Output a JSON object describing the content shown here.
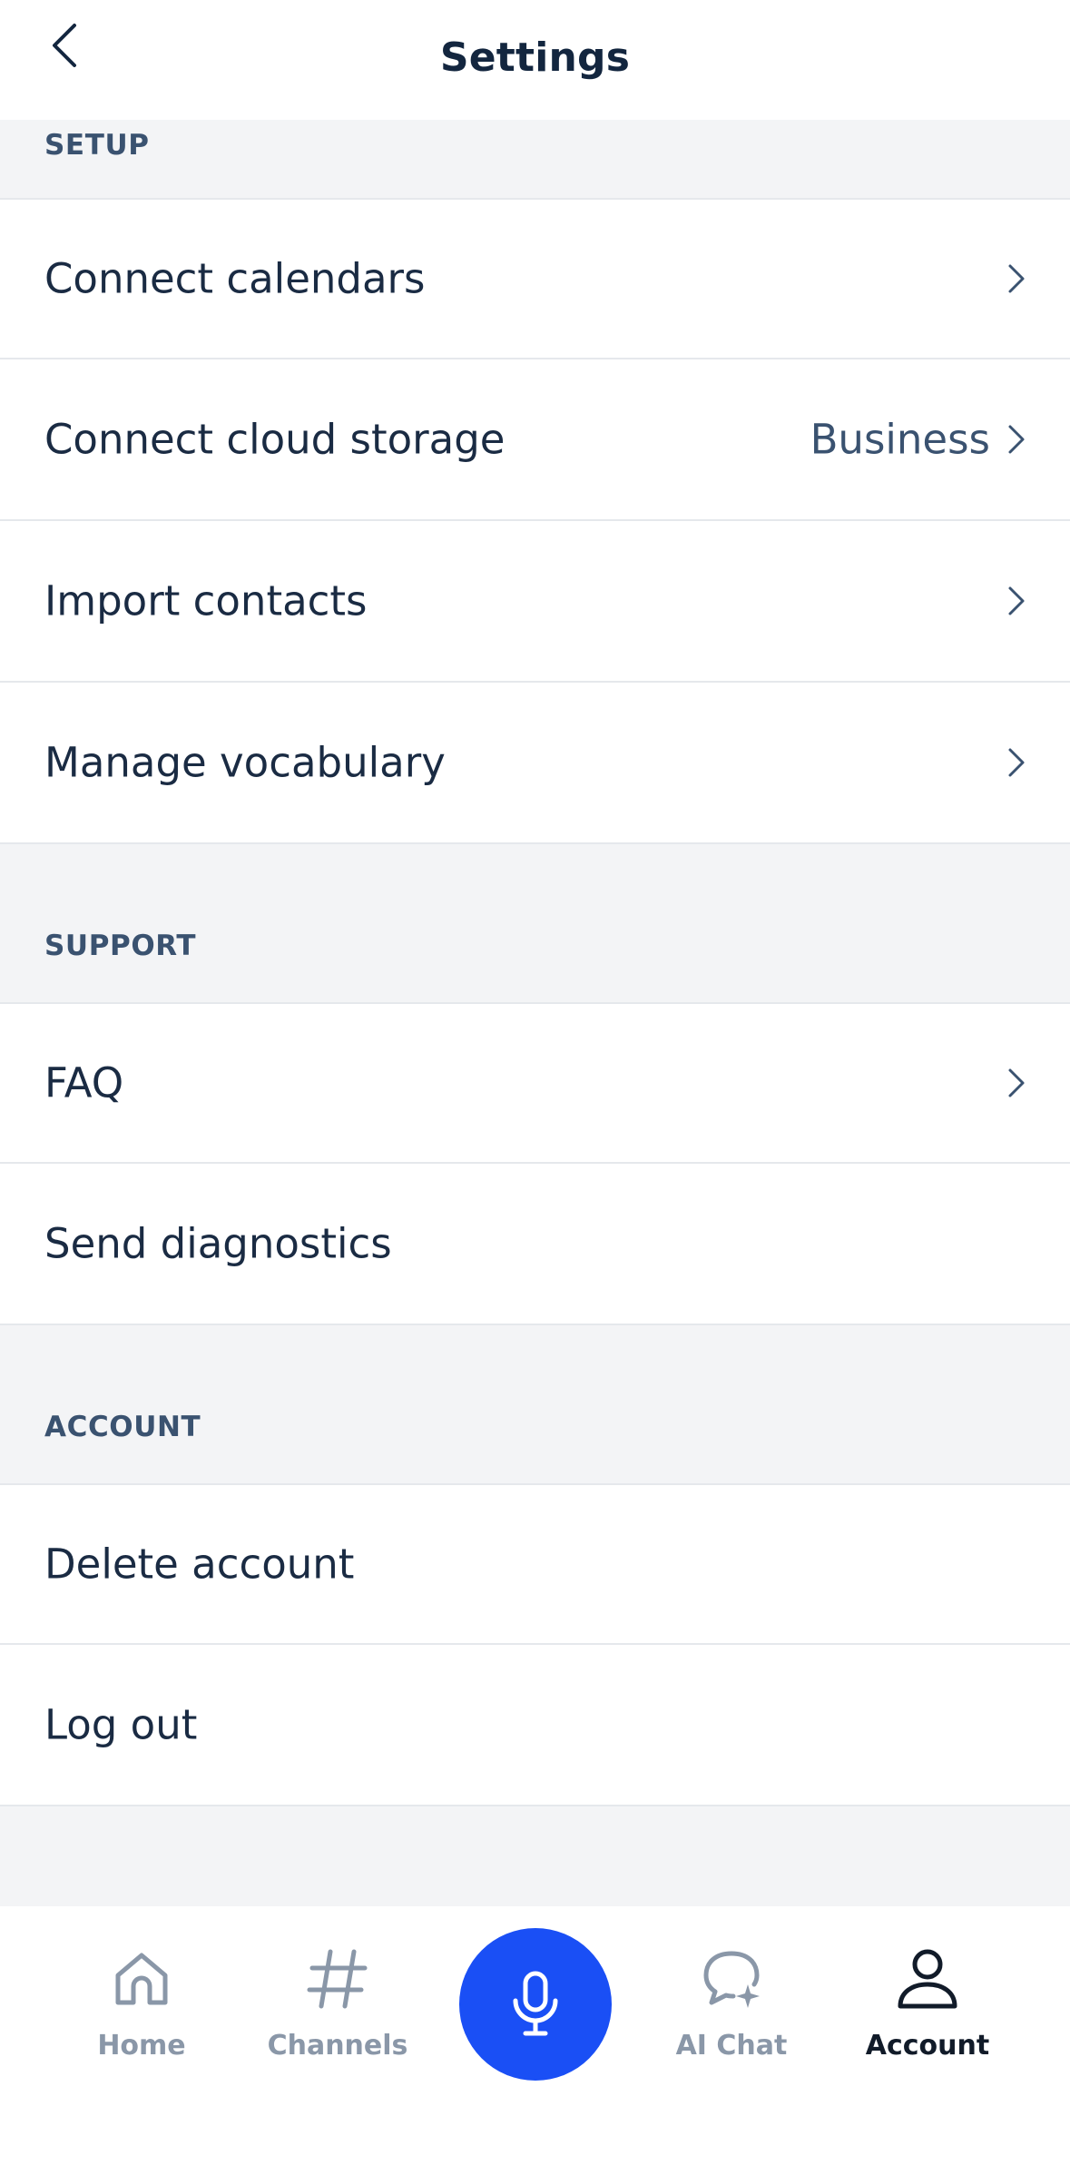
{
  "header": {
    "title": "Settings"
  },
  "sections": {
    "setup": {
      "label": "SETUP",
      "items": [
        {
          "label": "Connect calendars",
          "value": ""
        },
        {
          "label": "Connect cloud storage",
          "value": "Business"
        },
        {
          "label": "Import contacts",
          "value": ""
        },
        {
          "label": "Manage vocabulary",
          "value": ""
        }
      ]
    },
    "support": {
      "label": "SUPPORT",
      "items": [
        {
          "label": "FAQ"
        },
        {
          "label": "Send diagnostics"
        }
      ]
    },
    "account": {
      "label": "ACCOUNT",
      "items": [
        {
          "label": "Delete account"
        },
        {
          "label": "Log out"
        }
      ]
    }
  },
  "tabbar": {
    "active": "Account",
    "accent_color": "#1a4ff5",
    "items": [
      {
        "label": "Home",
        "icon": "home-icon"
      },
      {
        "label": "Channels",
        "icon": "hash-icon"
      },
      {
        "label": "",
        "icon": "microphone-icon"
      },
      {
        "label": "AI Chat",
        "icon": "ai-chat-icon"
      },
      {
        "label": "Account",
        "icon": "user-icon"
      }
    ]
  }
}
